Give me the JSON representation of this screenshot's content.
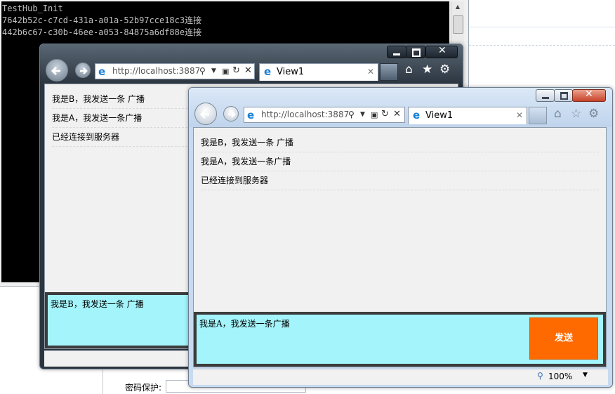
{
  "background_page": {
    "password_label": "密码保护:"
  },
  "console": {
    "lines": [
      "TestHub_Init",
      "7642b52c-c7cd-431a-a01a-52b97cce18c3连接",
      "442b6c67-c30b-46ee-a053-84875a6df88e连接"
    ]
  },
  "ie_back": {
    "address": "http://localhost:3887",
    "tab_title": "View1",
    "messages": [
      "我是B，我发送一条 广播",
      "我是A，我发送一条广播",
      "已经连接到服务器"
    ],
    "input_value": "我是B，我发送一条 广播"
  },
  "ie_front": {
    "address": "http://localhost:3887",
    "tab_title": "View1",
    "messages": [
      "我是B，我发送一条 广播",
      "我是A，我发送一条广播",
      "已经连接到服务器"
    ],
    "input_value": "我是A，我发送一条广播",
    "send_label": "发送",
    "zoom": "100%"
  },
  "colors": {
    "input_bg": "#a4f4fb",
    "send_bg": "#ff6a00",
    "console_bg": "#000000"
  }
}
